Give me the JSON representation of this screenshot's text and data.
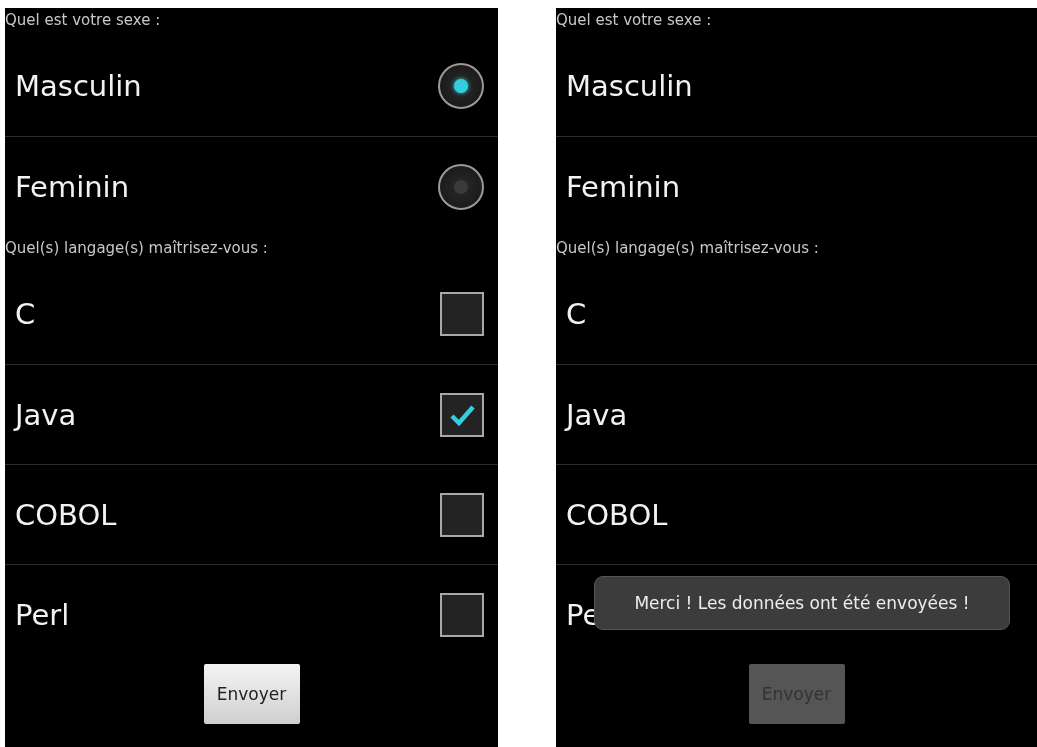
{
  "screens": [
    {
      "show_controls": true,
      "sex_label": "Quel est votre sexe :",
      "sex_options": [
        {
          "label": "Masculin",
          "selected": true
        },
        {
          "label": "Feminin",
          "selected": false
        }
      ],
      "lang_label": "Quel(s) langage(s) maîtrisez-vous :",
      "languages": [
        {
          "label": "C",
          "checked": false
        },
        {
          "label": "Java",
          "checked": true
        },
        {
          "label": "COBOL",
          "checked": false
        },
        {
          "label": "Perl",
          "checked": false
        }
      ],
      "button": {
        "label": "Envoyer",
        "disabled": false
      }
    },
    {
      "show_controls": false,
      "sex_label": "Quel est votre sexe :",
      "sex_options": [
        {
          "label": "Masculin"
        },
        {
          "label": "Feminin"
        }
      ],
      "lang_label": "Quel(s) langage(s) maîtrisez-vous :",
      "languages": [
        {
          "label": "C"
        },
        {
          "label": "Java"
        },
        {
          "label": "COBOL"
        },
        {
          "label": "Pe"
        }
      ],
      "button": {
        "label": "Envoyer",
        "disabled": true
      },
      "toast": "Merci ! Les données ont été envoyées !"
    }
  ]
}
